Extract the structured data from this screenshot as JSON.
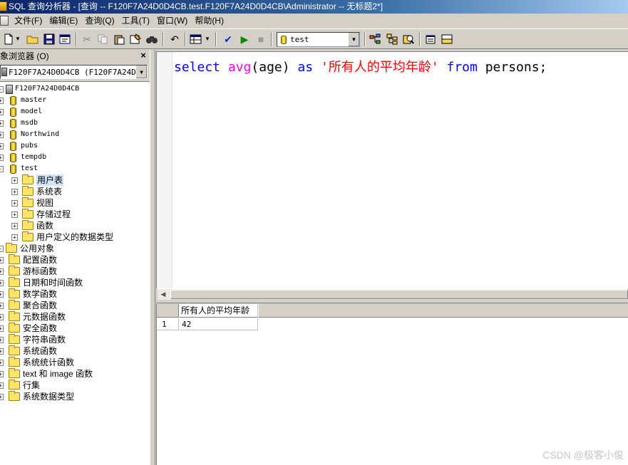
{
  "window": {
    "title": "SQL 查询分析器 - [查询 -- F120F7A24D0D4CB.test.F120F7A24D0D4CB\\Administrator -- 无标题2*]"
  },
  "menu": [
    "文件(F)",
    "编辑(E)",
    "查询(Q)",
    "工具(T)",
    "窗口(W)",
    "帮助(H)"
  ],
  "toolbar": {
    "database": "test"
  },
  "object_browser": {
    "title": "对象浏览器 (O)",
    "close_glyph": "×",
    "server_select": "F120F7A24D0D4CB (F120F7A24D0D4CB\\Administrator)",
    "root": "F120F7A24D0D4CB",
    "databases": [
      "master",
      "model",
      "msdb",
      "Northwind",
      "pubs",
      "tempdb",
      "test"
    ],
    "test_children": [
      "用户表",
      "系统表",
      "视图",
      "存储过程",
      "函数",
      "用户定义的数据类型"
    ],
    "common": "公用对象",
    "common_children": [
      "配置函数",
      "游标函数",
      "日期和时间函数",
      "数学函数",
      "聚合函数",
      "元数据函数",
      "安全函数",
      "字符串函数",
      "系统函数",
      "系统统计函数",
      "text 和 image 函数",
      "行集",
      "系统数据类型"
    ]
  },
  "editor": {
    "tokens": {
      "select": "select",
      "avg": "avg",
      "arg": "(age)",
      "as": "as",
      "alias": "'所有人的平均年龄'",
      "from": "from",
      "table": "persons;"
    }
  },
  "results": {
    "column": "所有人的平均年龄",
    "row_number": "1",
    "value": "42"
  },
  "watermark": "CSDN @极客小俊"
}
